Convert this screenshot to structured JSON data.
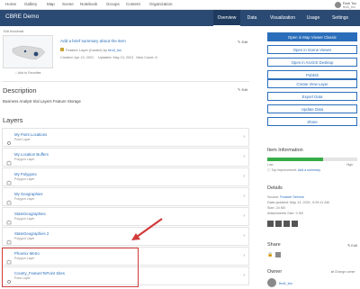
{
  "topnav": {
    "items": [
      "Home",
      "Gallery",
      "Map",
      "Scene",
      "Notebook",
      "Groups",
      "Content",
      "Organization"
    ],
    "user_name": "Feoll Tox",
    "user_sub": "feoll_tox"
  },
  "titlebar": {
    "title": "CBRE Demo",
    "tabs": [
      "Overview",
      "Data",
      "Visualization",
      "Usage",
      "Settings"
    ]
  },
  "summary": {
    "edit_thumbnail": "Edit thumbnail",
    "add_summary": "Add a brief summary about the item",
    "item_type_prefix": "Feature Layer (hosted) by",
    "owner_link": "feoll_tox",
    "created": "Created: Apr 13, 2021",
    "updated": "Updated: May 13, 2021",
    "view_count": "View Count: 6",
    "add_favorites": "Add to Favorites",
    "edit": "Edit"
  },
  "description": {
    "heading": "Description",
    "text": "Business Analyst trial Layers Feature Storage",
    "edit": "Edit"
  },
  "layers": {
    "heading": "Layers",
    "items": [
      {
        "name": "My Point Locations",
        "type": "Point Layer"
      },
      {
        "name": "My Location Buffers",
        "type": "Polygon Layer"
      },
      {
        "name": "My Polygons",
        "type": "Polygon Layer"
      },
      {
        "name": "My Geographies",
        "type": "Polygon Layer"
      },
      {
        "name": "StateGeographies",
        "type": "Polygon Layer"
      },
      {
        "name": "StateGeographies 2",
        "type": "Polygon Layer"
      },
      {
        "name": "Phoenix Metro",
        "type": "Polygon Layer"
      },
      {
        "name": "County_FeatureToPoint Sites",
        "type": "Point Layer"
      },
      {
        "name": "County_FeatureToPoint Sites Buffers",
        "type": "Polygon Layer"
      }
    ]
  },
  "actions": {
    "buttons": [
      "Open in Map Viewer Classic",
      "Open in Scene Viewer",
      "Open in ArcGIS Desktop",
      "Publish",
      "Create View Layer",
      "Export Data",
      "Update Data",
      "Share"
    ]
  },
  "item_info": {
    "heading": "Item Information",
    "low": "Low",
    "high": "High",
    "progress": 0.62,
    "top_improvement": "Top improvement:",
    "add_summary": "Add a summary"
  },
  "details": {
    "heading": "Details",
    "source_label": "Source:",
    "source_value": "Feature Service",
    "data_updated": "Data updated: May 13, 2021, 9:29:11 AM",
    "size": "Size: 24 KB",
    "attachments": "Attachments Size: 0 KB"
  },
  "share": {
    "heading": "Share",
    "edit": "Edit"
  },
  "owner": {
    "heading": "Owner",
    "change_owner": "Change owner",
    "name": "feoll_tox"
  },
  "colors": {
    "brand": "#2b4a73",
    "accent": "#2a6ebb",
    "highlight": "#d23b3b",
    "progress": "#35ac46"
  }
}
